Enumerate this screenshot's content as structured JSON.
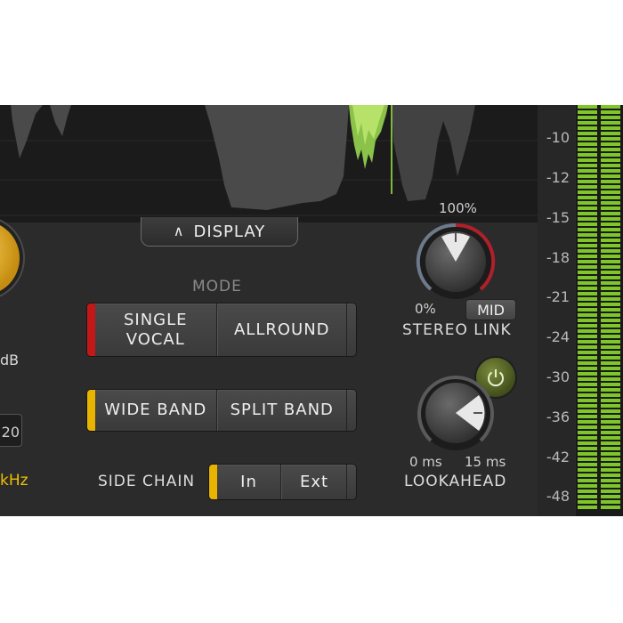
{
  "display": {
    "label": "DISPLAY"
  },
  "left_panel": {
    "db_label": "dB",
    "value_box": "20",
    "freq_label": "kHz"
  },
  "mode": {
    "label": "MODE",
    "options": [
      {
        "label_line1": "SINGLE",
        "label_line2": "VOCAL"
      },
      {
        "label": "ALLROUND"
      }
    ],
    "indicator_color": "#c41818"
  },
  "band": {
    "options": [
      "WIDE BAND",
      "SPLIT BAND"
    ],
    "indicator_color": "#e8b400"
  },
  "side_chain": {
    "label": "SIDE CHAIN",
    "options": [
      "In",
      "Ext"
    ],
    "indicator_color": "#e8b400"
  },
  "stereo_link": {
    "label": "STEREO LINK",
    "max_label": "100%",
    "min_label": "0%",
    "mode_button": "MID",
    "value_fraction": 0.5
  },
  "lookahead": {
    "label": "LOOKAHEAD",
    "min_label": "0 ms",
    "max_label": "15 ms",
    "value_fraction": 0.95
  },
  "scale": {
    "ticks": [
      "-10",
      "-12",
      "-15",
      "-18",
      "-21",
      "-24",
      "-30",
      "-36",
      "-42",
      "-48"
    ]
  },
  "colors": {
    "accent_yellow": "#f0c000",
    "meter_green": "#7fc62a",
    "power_green": "#6e7f30"
  }
}
